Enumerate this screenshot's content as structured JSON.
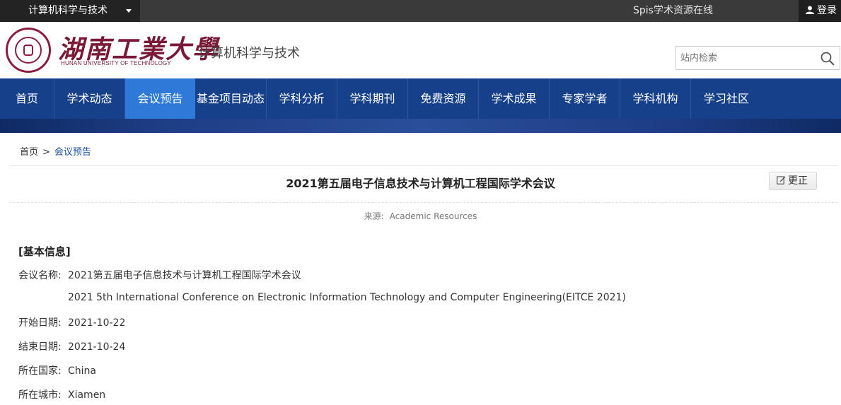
{
  "topbar": {
    "site_select": "计算机科学与技术",
    "title": "Spis学术资源在线",
    "login": "登录"
  },
  "header": {
    "logo_cn": "湖南工業大學",
    "logo_en": "HUNAN UNIVERSITY OF TECHNOLOGY",
    "dept": "计算机科学与技术",
    "search_placeholder": "站内检索"
  },
  "nav": {
    "items": [
      {
        "label": "首页"
      },
      {
        "label": "学术动态"
      },
      {
        "label": "会议预告"
      },
      {
        "label": "基金项目动态"
      },
      {
        "label": "学科分析"
      },
      {
        "label": "学科期刊"
      },
      {
        "label": "免费资源"
      },
      {
        "label": "学术成果"
      },
      {
        "label": "专家学者"
      },
      {
        "label": "学科机构"
      },
      {
        "label": "学习社区"
      }
    ],
    "active": "会议预告"
  },
  "breadcrumb": {
    "home": "首页",
    "separator": ">",
    "current": "会议预告"
  },
  "article": {
    "title": "2021第五届电子信息技术与计算机工程国际学术会议",
    "fix_button": "更正",
    "source_label": "来源:",
    "source_value": "Academic Resources"
  },
  "info": {
    "section_title": "[基本信息]",
    "name_label": "会议名称:",
    "name_cn": "2021第五届电子信息技术与计算机工程国际学术会议",
    "name_en": "2021 5th International Conference on Electronic Information Technology and Computer Engineering(EITCE 2021)",
    "start_label": "开始日期:",
    "start_value": "2021-10-22",
    "end_label": "结束日期:",
    "end_value": "2021-10-24",
    "country_label": "所在国家:",
    "country_value": "China",
    "city_label": "所在城市:",
    "city_value": "Xiamen"
  }
}
